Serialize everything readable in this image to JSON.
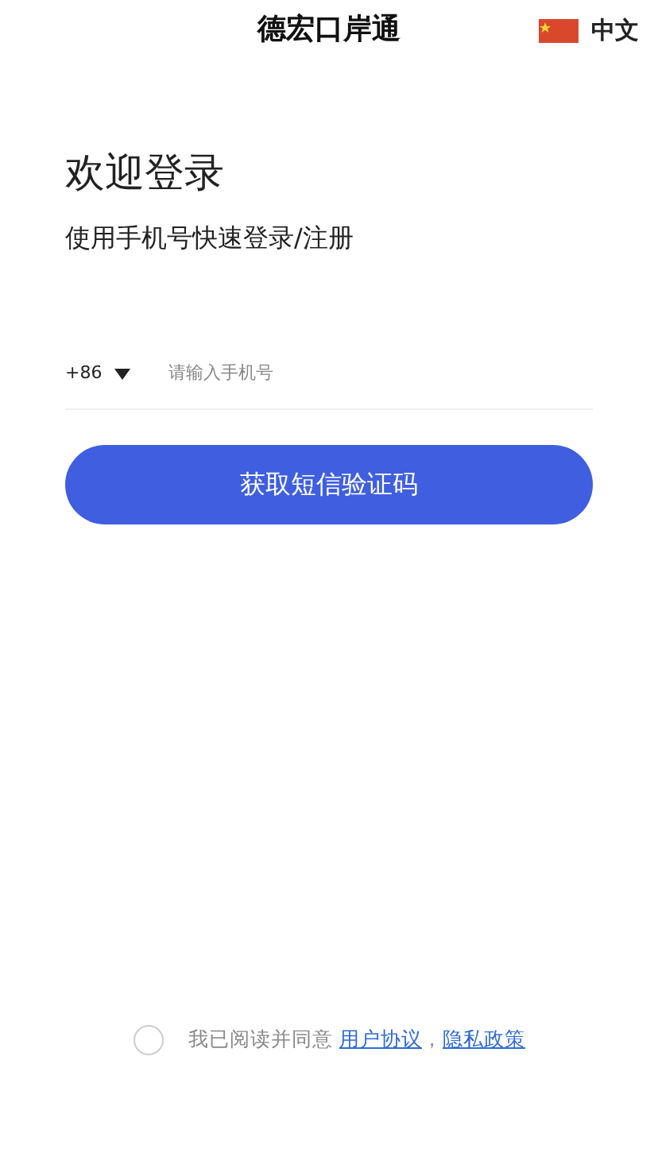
{
  "header": {
    "title": "德宏口岸通",
    "language": "中文"
  },
  "heading": "欢迎登录",
  "subtitle": "使用手机号快速登录/注册",
  "phone": {
    "country_code": "+86",
    "placeholder": "请输入手机号"
  },
  "submit_button": "获取短信验证码",
  "agreement": {
    "checked": false,
    "text": "我已阅读并同意",
    "links": [
      "用户协议",
      "隐私政策"
    ],
    "separator": "，"
  }
}
